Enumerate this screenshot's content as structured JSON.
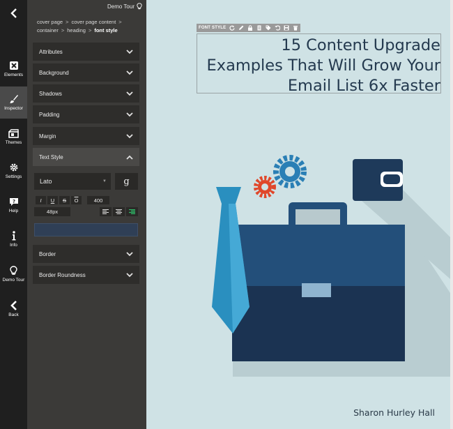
{
  "rail": {
    "back_top_icon": "chevron-left-icon",
    "items": [
      {
        "label": "Elements",
        "icon": "elements-icon"
      },
      {
        "label": "Inspector",
        "icon": "brush-icon"
      },
      {
        "label": "Themes",
        "icon": "themes-icon"
      },
      {
        "label": "Settings",
        "icon": "gear-icon"
      },
      {
        "label": "Help",
        "icon": "help-icon"
      },
      {
        "label": "Info",
        "icon": "info-icon"
      },
      {
        "label": "Demo Tour",
        "icon": "lightbulb-icon"
      },
      {
        "label": "Back",
        "icon": "chevron-left-icon"
      }
    ],
    "active": "Inspector"
  },
  "panel": {
    "demo_tour": "Demo Tour",
    "breadcrumb": [
      "cover page",
      "cover page content",
      "container",
      "heading",
      "font style"
    ],
    "sections": {
      "attributes": "Attributes",
      "background": "Background",
      "shadows": "Shadows",
      "padding": "Padding",
      "margin": "Margin",
      "text_style": "Text Style",
      "border": "Border",
      "border_roundness": "Border Roundness"
    },
    "text_style": {
      "font": "Lato",
      "google_fonts_glyph": "g",
      "italic": "I",
      "underline": "U",
      "strike": "S",
      "overline": "O",
      "weight": "400",
      "size": "48px",
      "color": "#2f3f56"
    }
  },
  "canvas": {
    "toolbar_label": "FONT STYLE",
    "heading": "15 Content Upgrade Examples That Will Grow Your Email List 6x Faster",
    "author": "Sharon Hurley Hall",
    "colors": {
      "cover_bg": "#cfe2e5",
      "heading": "#243a4f",
      "briefcase": "#234f7a",
      "briefcase_dark": "#1b3352",
      "tie": "#2a8fbf",
      "gear_blue": "#2a7fb5",
      "gear_orange": "#e0472a"
    }
  }
}
